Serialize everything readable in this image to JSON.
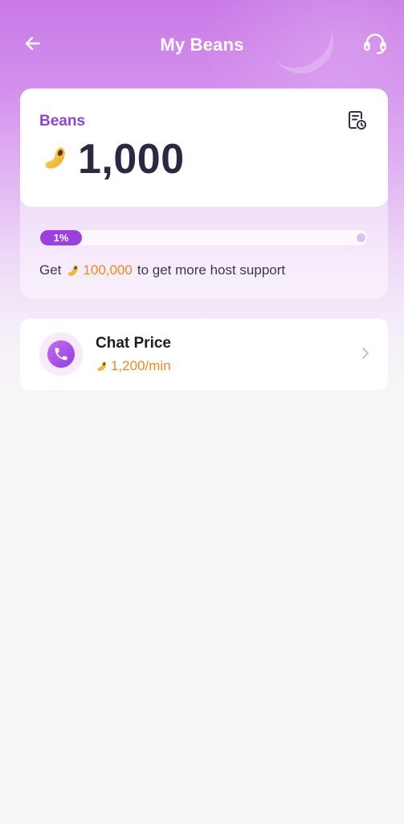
{
  "header": {
    "title": "My Beans",
    "back_icon": "arrow-left-icon",
    "support_icon": "headset-icon"
  },
  "beans_card": {
    "label": "Beans",
    "balance": "1,000",
    "coin_icon": "bean-icon",
    "record_icon": "record-icon",
    "progress": {
      "percent_label": "1%",
      "value": 0.01
    },
    "hint": {
      "prefix": "Get",
      "amount": "100,000",
      "suffix": "to get more host support"
    }
  },
  "chat_price": {
    "title": "Chat Price",
    "price": "1,200/min",
    "icon": "phone-icon"
  },
  "colors": {
    "accent": "#9b3fe0",
    "label_purple": "#8e44d6",
    "orange": "#ef8a1d",
    "balance_text": "#2e2744"
  }
}
